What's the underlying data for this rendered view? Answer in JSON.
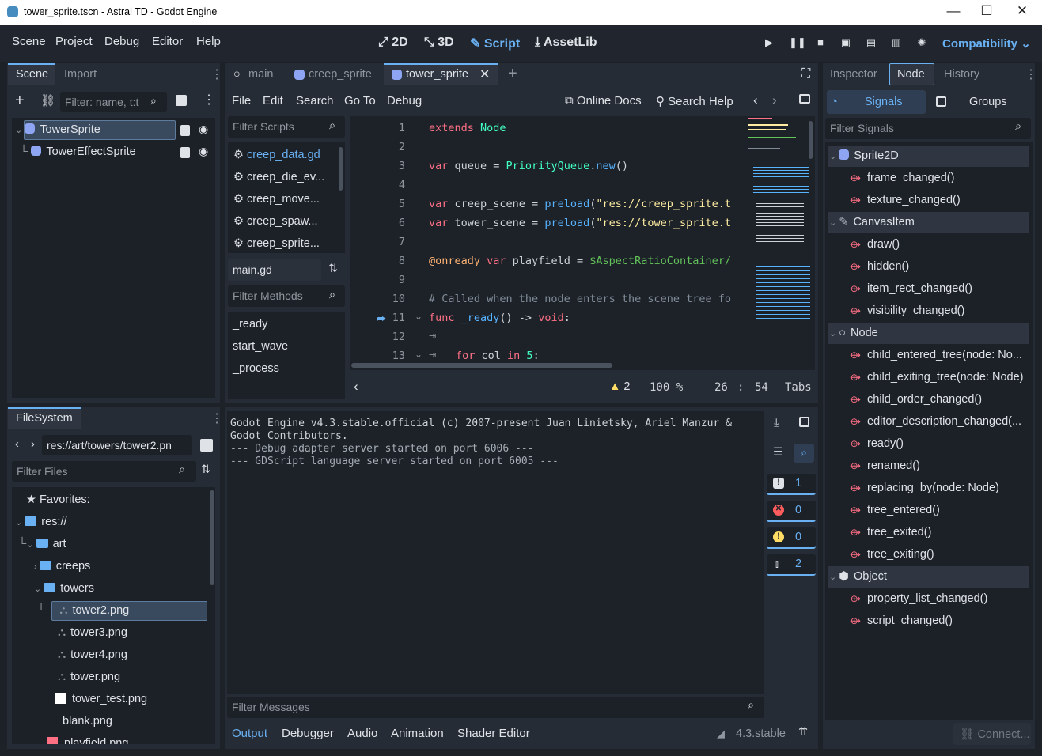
{
  "window": {
    "title": "tower_sprite.tscn - Astral TD - Godot Engine"
  },
  "menu": [
    "Scene",
    "Project",
    "Debug",
    "Editor",
    "Help"
  ],
  "modes": [
    "2D",
    "3D",
    "Script",
    "AssetLib"
  ],
  "renderer": "Compatibility",
  "scene_panel": {
    "tabs": [
      "Scene",
      "Import"
    ],
    "filter_placeholder": "Filter: name, t:t",
    "nodes": [
      "TowerSprite",
      "TowerEffectSprite"
    ]
  },
  "filesystem": {
    "title": "FileSystem",
    "path": "res://art/towers/tower2.pn",
    "filter_placeholder": "Filter Files",
    "items": [
      "Favorites:",
      "res://",
      "art",
      "creeps",
      "towers",
      "tower2.png",
      "tower3.png",
      "tower4.png",
      "tower.png",
      "tower_test.png",
      "blank.png",
      "playfield.png"
    ]
  },
  "script_editor": {
    "tabs": [
      "main",
      "creep_sprite",
      "tower_sprite"
    ],
    "menu": [
      "File",
      "Edit",
      "Search",
      "Go To",
      "Debug"
    ],
    "online_docs": "Online Docs",
    "search_help": "Search Help",
    "filter_scripts_placeholder": "Filter Scripts",
    "scripts": [
      "creep_data.gd",
      "creep_die_ev...",
      "creep_move...",
      "creep_spaw...",
      "creep_sprite..."
    ],
    "current_script": "main.gd",
    "filter_methods_placeholder": "Filter Methods",
    "methods": [
      "_ready",
      "start_wave",
      "_process"
    ],
    "line_numbers": [
      "1",
      "2",
      "3",
      "4",
      "5",
      "6",
      "7",
      "8",
      "9",
      "10",
      "11",
      "12",
      "13"
    ],
    "code": {
      "l1a": "extends ",
      "l1b": "Node",
      "l3a": "var ",
      "l3b": "queue = ",
      "l3c": "PriorityQueue",
      "l3d": ".",
      "l3e": "new",
      "l3f": "()",
      "l5a": "var ",
      "l5b": "creep_scene = ",
      "l5c": "preload",
      "l5d": "(",
      "l5e": "\"res://creep_sprite.t",
      "l6a": "var ",
      "l6b": "tower_scene = ",
      "l6c": "preload",
      "l6d": "(",
      "l6e": "\"res://tower_sprite.t",
      "l8a": "@onready ",
      "l8b": "var ",
      "l8c": "playfield = ",
      "l8d": "$AspectRatioContainer/",
      "l10": "# Called when the node enters the scene tree fo",
      "l11a": "func ",
      "l11b": "_ready",
      "l11c": "() -> ",
      "l11d": "void",
      "l11e": ":",
      "l13a": "for ",
      "l13b": "col ",
      "l13c": "in ",
      "l13d": "5",
      "l13e": ":"
    },
    "status": {
      "warnings": "2",
      "zoom": "100 %",
      "line": "26",
      "sep": ":",
      "col": "54",
      "indent": "Tabs"
    }
  },
  "output": {
    "lines": [
      "Godot Engine v4.3.stable.official (c) 2007-present Juan Linietsky, Ariel Manzur &",
      "Godot Contributors.",
      "--- Debug adapter server started on port 6006 ---",
      "--- GDScript language server started on port 6005 ---"
    ],
    "filter_placeholder": "Filter Messages",
    "counts": {
      "messages": "1",
      "errors": "0",
      "warnings": "0",
      "other": "2"
    },
    "tabs": [
      "Output",
      "Debugger",
      "Audio",
      "Animation",
      "Shader Editor"
    ],
    "version": "4.3.stable"
  },
  "node_dock": {
    "tabs": [
      "Inspector",
      "Node",
      "History"
    ],
    "subtabs": [
      "Signals",
      "Groups"
    ],
    "filter_placeholder": "Filter Signals",
    "sections": [
      "Sprite2D",
      "CanvasItem",
      "Node",
      "Object"
    ],
    "signals_sprite2d": [
      "frame_changed()",
      "texture_changed()"
    ],
    "signals_canvasitem": [
      "draw()",
      "hidden()",
      "item_rect_changed()",
      "visibility_changed()"
    ],
    "signals_node": [
      "child_entered_tree(node: No...",
      "child_exiting_tree(node: Node)",
      "child_order_changed()",
      "editor_description_changed(...",
      "ready()",
      "renamed()",
      "replacing_by(node: Node)",
      "tree_entered()",
      "tree_exited()",
      "tree_exiting()"
    ],
    "signals_object": [
      "property_list_changed()",
      "script_changed()"
    ],
    "connect": "Connect..."
  },
  "colors": {
    "accent": "#6ab1f3",
    "background": "#1d2229",
    "panel": "#262c35"
  }
}
